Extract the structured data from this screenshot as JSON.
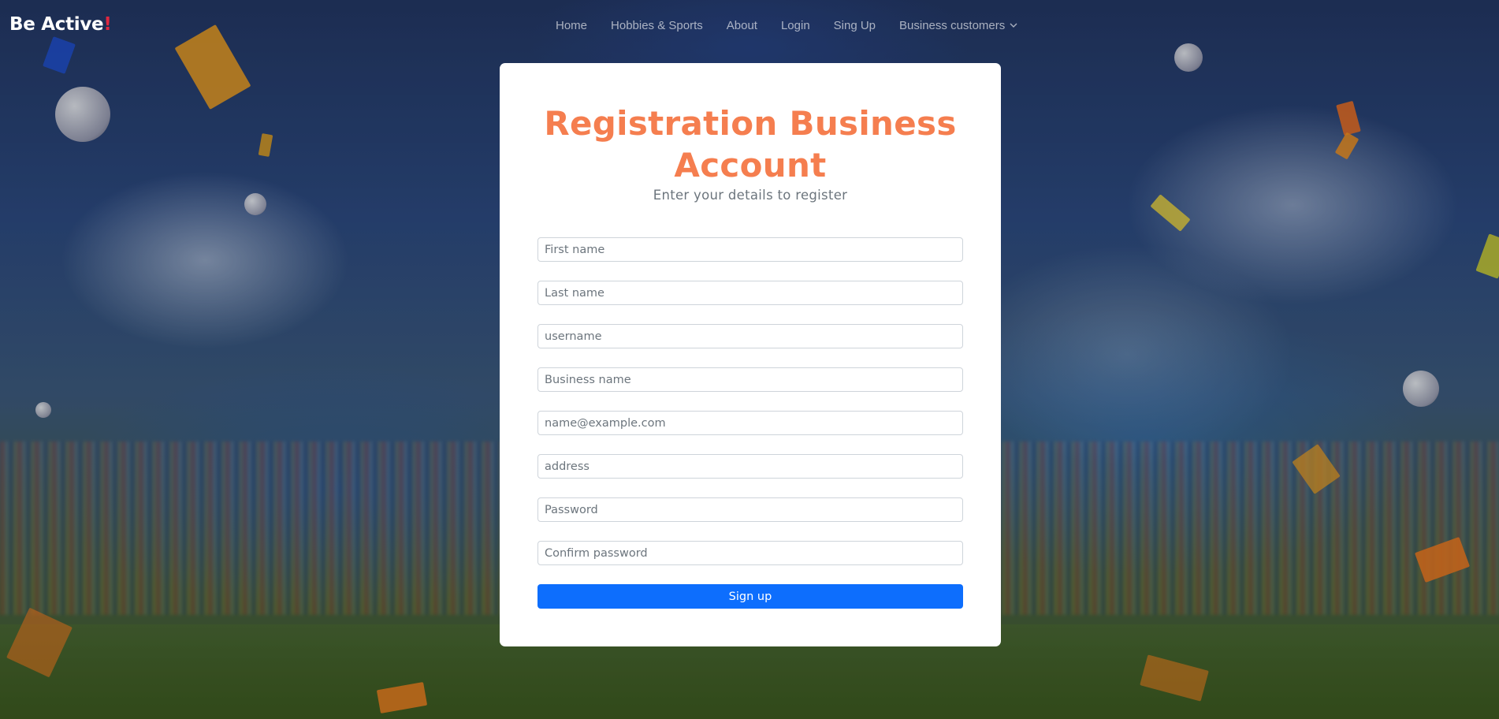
{
  "brand": {
    "name": "Be Active",
    "accent": "!"
  },
  "nav": {
    "items": [
      "Home",
      "Hobbies & Sports",
      "About",
      "Login",
      "Sing Up"
    ],
    "dropdown_label": "Business customers"
  },
  "form": {
    "title": "Registration Business Account",
    "subtitle": "Enter your details to register",
    "fields": {
      "first_name": "First name",
      "last_name": "Last name",
      "username": "username",
      "business_name": "Business name",
      "email": "name@example.com",
      "address": "address",
      "password": "Password",
      "confirm_password": "Confirm password"
    },
    "submit_label": "Sign up"
  },
  "colors": {
    "title": "#f57e4f",
    "button": "#0d6efd",
    "brand_accent": "#e0273f"
  }
}
